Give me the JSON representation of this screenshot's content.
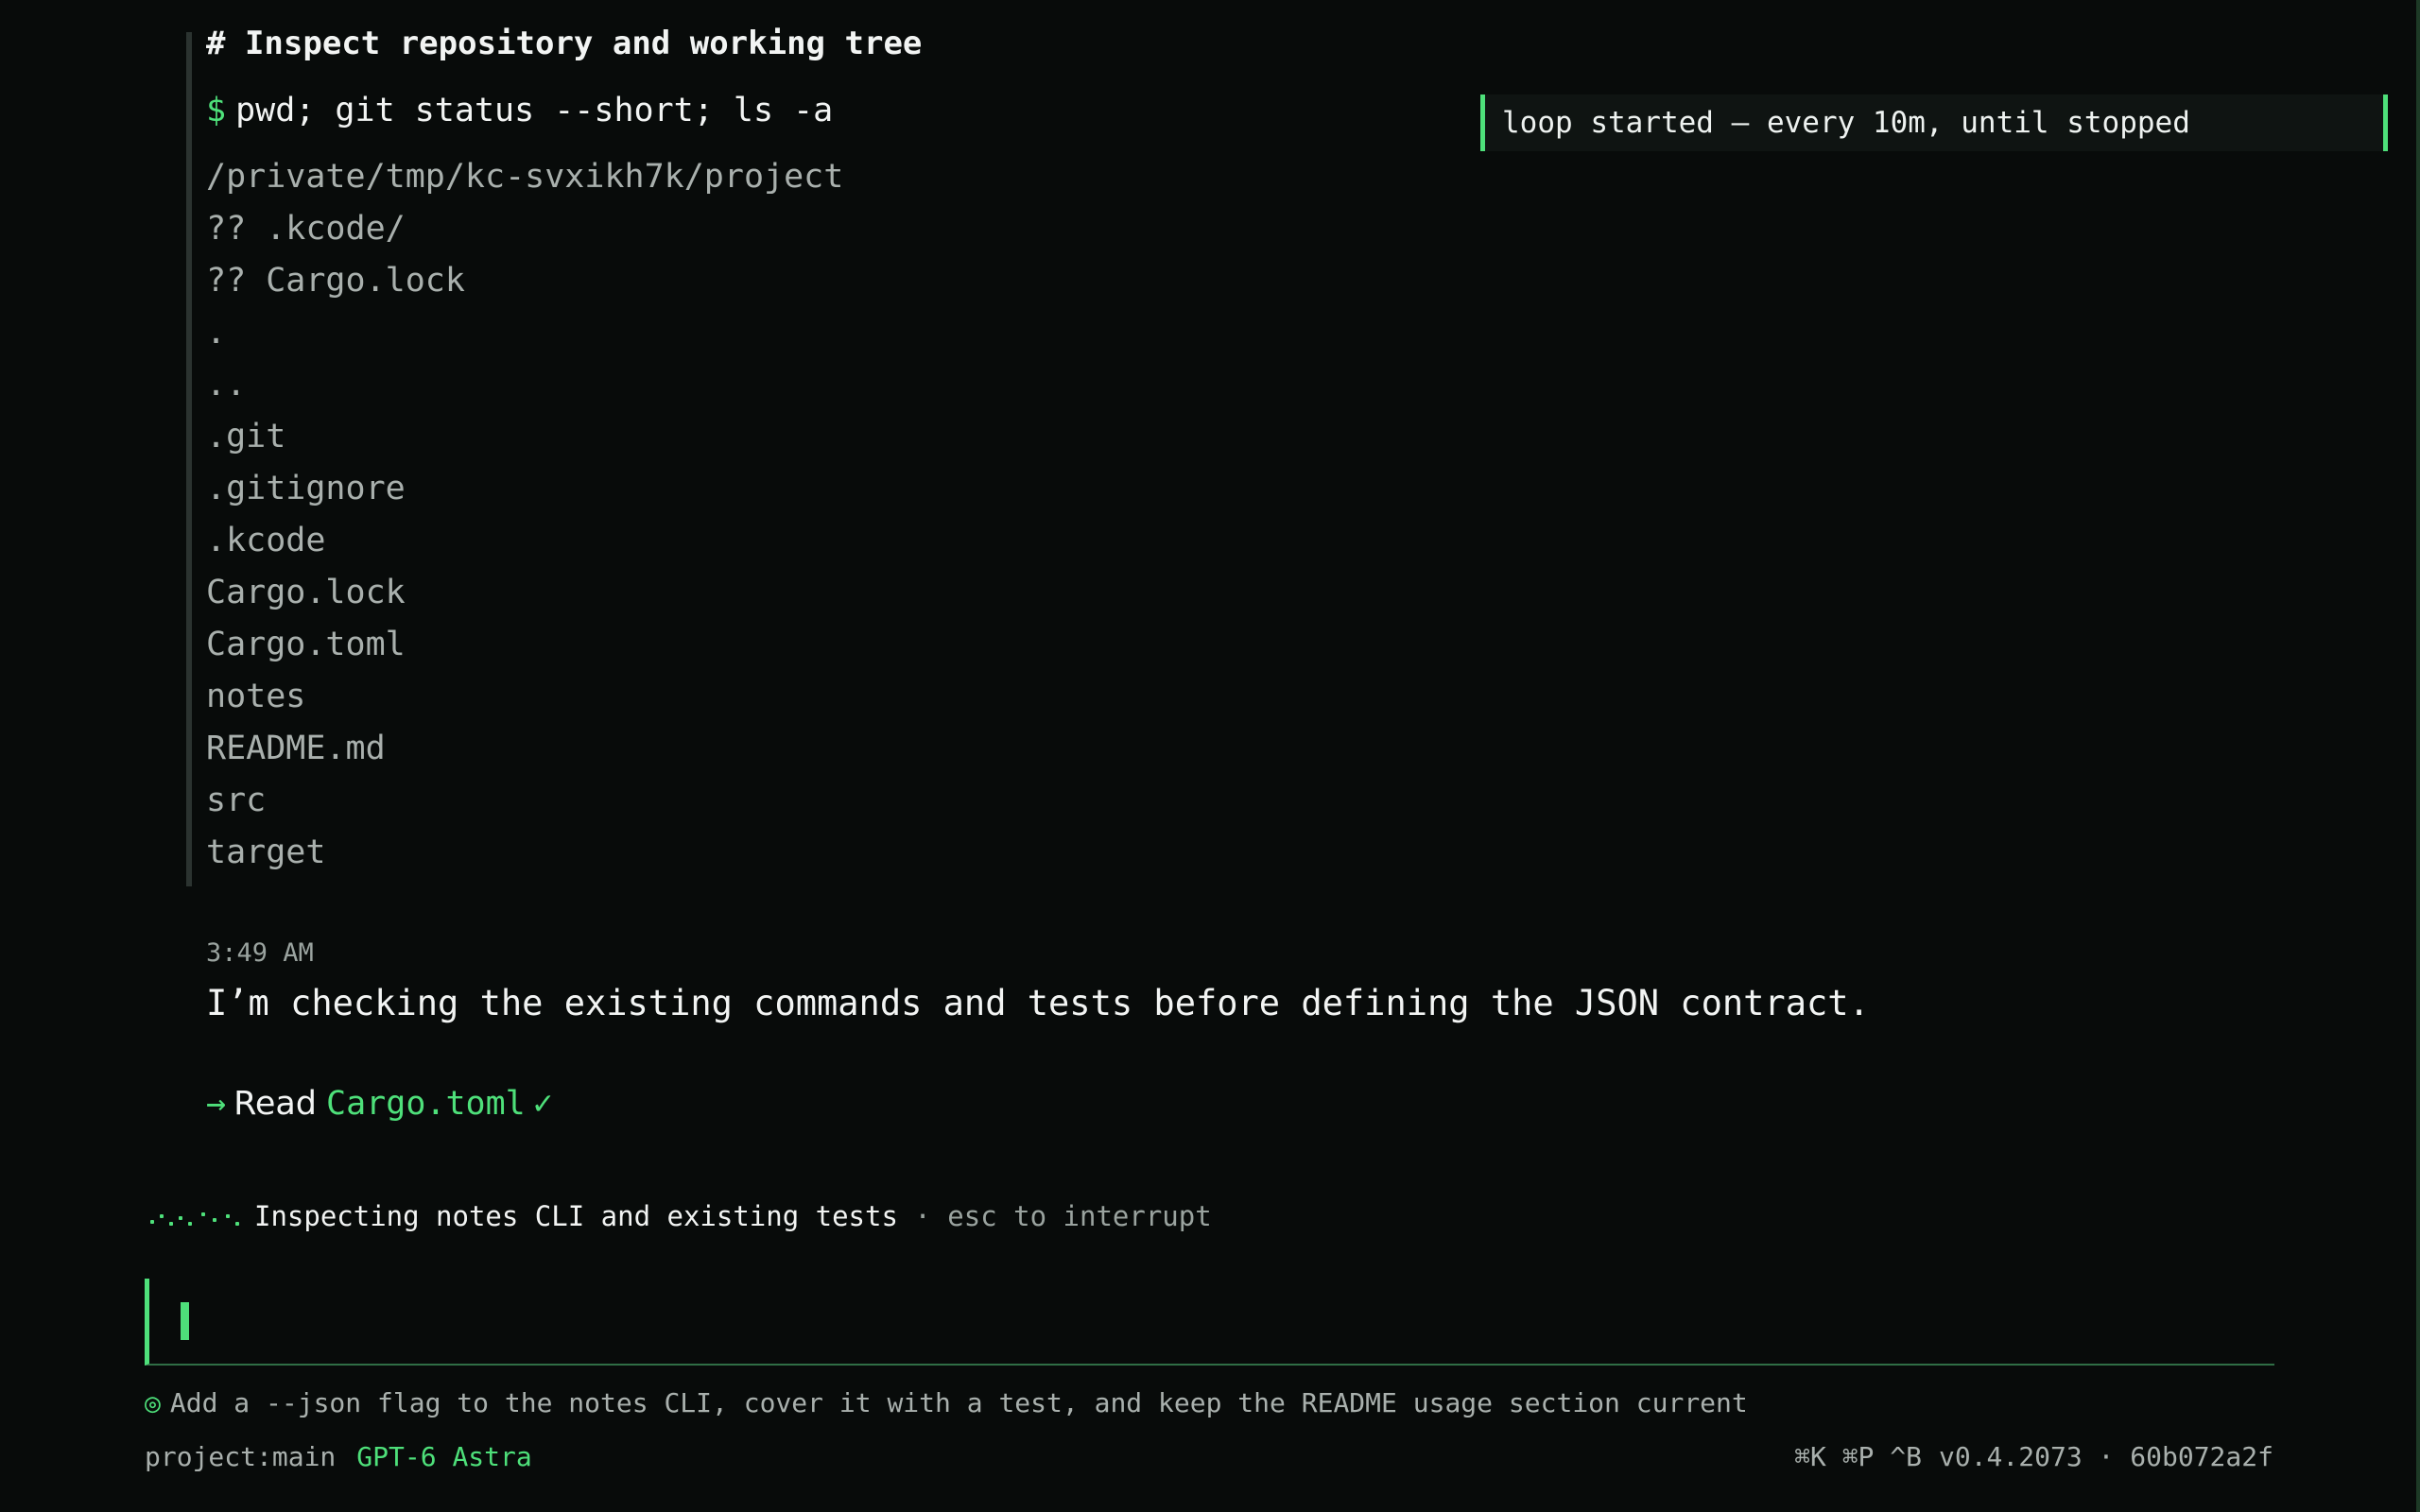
{
  "tool_block": {
    "title": "# Inspect repository and working tree",
    "prompt_symbol": "$",
    "command": "pwd; git status --short; ls -a",
    "output": [
      "/private/tmp/kc-svxikh7k/project",
      "?? .kcode/",
      "?? Cargo.lock",
      ".",
      "..",
      ".git",
      ".gitignore",
      ".kcode",
      "Cargo.lock",
      "Cargo.toml",
      "notes",
      "README.md",
      "src",
      "target"
    ]
  },
  "notice": {
    "text": "loop started — every 10m, until stopped"
  },
  "message": {
    "timestamp": "3:49 AM",
    "text": "I’m checking the existing commands and tests before defining the JSON contract."
  },
  "read_action": {
    "arrow": "→",
    "verb": "Read",
    "file": "Cargo.toml",
    "status": "✓"
  },
  "activity": {
    "text": "Inspecting notes CLI and existing tests",
    "hint": "· esc to interrupt"
  },
  "input": {
    "value": ""
  },
  "task": {
    "icon": "◎",
    "text": "Add a --json flag to the notes CLI, cover it with a test, and keep the README usage section current"
  },
  "footer": {
    "project": "project:main",
    "model": "GPT-6 Astra",
    "shortcuts": "⌘K ⌘P ^B",
    "version": "v0.4.2073 · 60b072a2f"
  },
  "colors": {
    "accent": "#4ee07a",
    "background": "#080b0a",
    "muted": "#a9b0ad"
  }
}
